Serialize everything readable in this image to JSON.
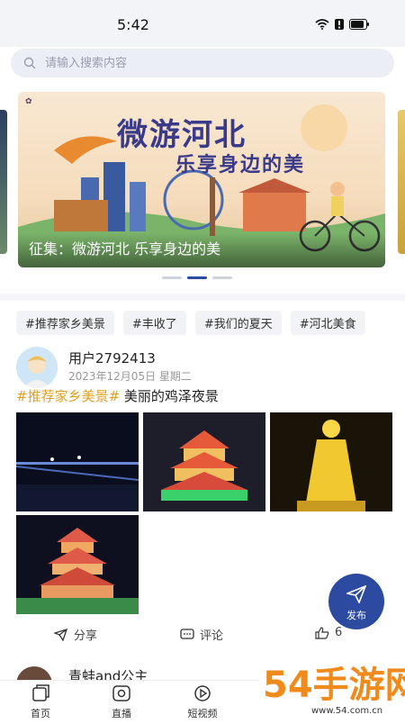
{
  "status": {
    "time": "5:42"
  },
  "search": {
    "placeholder": "请输入搜索内容"
  },
  "banner": {
    "title_line1": "微游河北",
    "title_line2": "乐享身边的美",
    "caption": "征集：微游河北 乐享身边的美",
    "pages": 3,
    "active_page": 2
  },
  "tags": [
    "#推荐家乡美景",
    "#丰收了",
    "#我们的夏天",
    "#河北美食"
  ],
  "post": {
    "username": "用户2792413",
    "date": "2023年12月05日 星期二",
    "hashtag": "#推荐家乡美景#",
    "text": " 美丽的鸡泽夜景",
    "image_count": 4,
    "actions": {
      "share": "分享",
      "comment": "评论",
      "like_count": "6"
    }
  },
  "fab": {
    "label": "发布"
  },
  "next_post": {
    "username": "青蛙and公主"
  },
  "tabbar": [
    {
      "label": "首页",
      "icon": "home-icon"
    },
    {
      "label": "直播",
      "icon": "live-icon"
    },
    {
      "label": "短视频",
      "icon": "video-icon"
    }
  ],
  "watermark": {
    "text": "54手游网",
    "subtext": "www.54.com.cn"
  },
  "colors": {
    "accent": "#2c4aa0",
    "hashtag": "#e0a020"
  }
}
